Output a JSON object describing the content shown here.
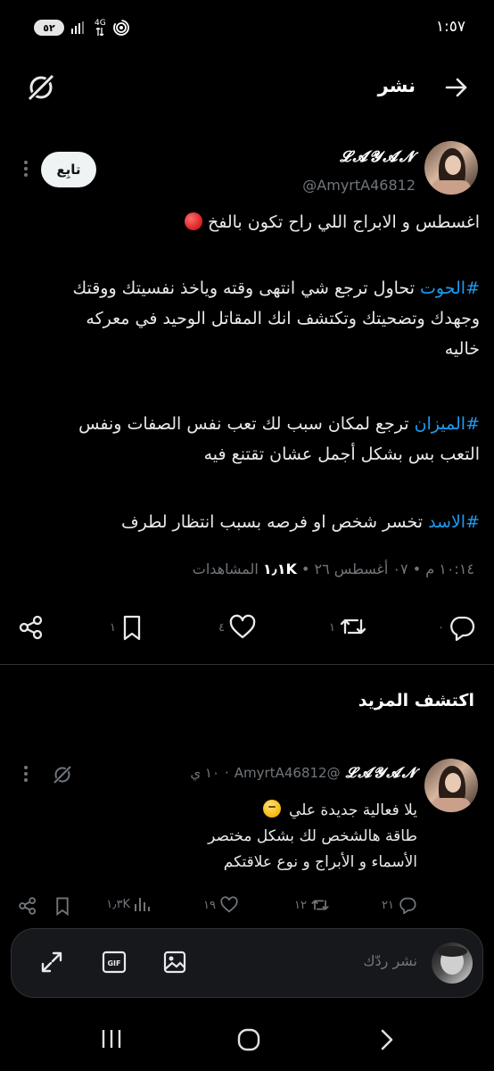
{
  "status_bar": {
    "time": "١:٥٧",
    "battery": "٥٢",
    "network": "4G"
  },
  "header": {
    "title": "نشر"
  },
  "tweet": {
    "author_name": "𝓛𝓐𝓨𝓐𝓝",
    "author_handle": "@AmyrtA46812",
    "follow_label": "تابِع",
    "line1": "اغسطس و الابراج اللي راح تكون بالفخ",
    "para1_tag": "#الحوت",
    "para1_line1": " تحاول ترجع شي انتهى وقته وياخذ نفسيتك ووقتك",
    "para1_line2": "وجهدك وتضحيتك وتكتشف انك المقاتل الوحيد في معركه",
    "para1_line3": "خاليه",
    "para2_tag": "#الميزان",
    "para2_line1": " ترجع لمكان سبب لك تعب نفس الصفات ونفس",
    "para2_line2": "التعب بس بشكل أجمل عشان تقتنع فيه",
    "para3_tag": "#الاسد",
    "para3_line1": " تخسر شخص او فرصه بسبب انتظار لطرف",
    "meta_time": "١٠:١٤ م • ٠٧ أغسطس ٢٦ • ",
    "meta_views_count": "١٫١K",
    "meta_views_label": " المشاهدات",
    "actions": {
      "replies": "٠",
      "reposts": "١",
      "likes": "٤",
      "bookmarks": "١"
    }
  },
  "discover": {
    "title": "اكتشف المزيد"
  },
  "tweet2": {
    "author_name": "𝓛𝓐𝓨𝓐𝓝",
    "author_handle": "@AmyrtA46812",
    "time": "١٠ ي",
    "line1": "يلا فعالية جديدة علي",
    "line2": "طاقة هالشخص لك بشكل مختصر",
    "line3": "الأسماء و الأبراج و نوع علاقتكم",
    "actions": {
      "replies": "٢١",
      "reposts": "١٢",
      "likes": "١٩",
      "views": "١٫٣K"
    }
  },
  "composer": {
    "placeholder": "نشر ردّك"
  },
  "icons": [
    "grok-icon",
    "back-arrow-icon",
    "share-icon",
    "bookmark-icon",
    "like-icon",
    "repost-icon",
    "reply-icon",
    "views-icon",
    "expand-icon",
    "gif-icon",
    "image-icon"
  ],
  "colors": {
    "accent": "#1d9bf0",
    "muted": "#71767b",
    "background": "#000000"
  }
}
